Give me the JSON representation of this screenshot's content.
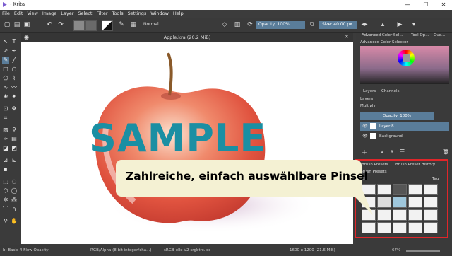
{
  "window": {
    "title": "- Krita",
    "minimize": "—",
    "maximize": "☐",
    "close": "✕"
  },
  "menu": [
    "File",
    "Edit",
    "View",
    "Image",
    "Layer",
    "Select",
    "Filter",
    "Tools",
    "Settings",
    "Window",
    "Help"
  ],
  "toolbar": {
    "blend_mode": "Normal",
    "opacity_label": "Opacity: 100%",
    "size_label": "Size: 40.00 px"
  },
  "canvas": {
    "tab_title": "Apple.kra (20.2 MiB)",
    "close": "✕",
    "watermark": "SAMPLE"
  },
  "dockers": {
    "color_tabs": [
      "Advanced Color Sel...",
      "Tool Op...",
      "Ove..."
    ],
    "color_selector_title": "Advanced Color Selector",
    "layer_tabs": [
      "Layers",
      "Channels"
    ],
    "layers_title": "Layers",
    "blend_mode": "Multiply",
    "opacity": "Opacity: 100%",
    "layers": [
      {
        "name": "Layer 8",
        "selected": true
      },
      {
        "name": "Background",
        "selected": false
      }
    ],
    "brush_tabs": [
      "Brush Presets",
      "Brush Preset History"
    ],
    "brush_presets_title": "Brush Presets",
    "tag_filter": "All",
    "tag_label": "Tag"
  },
  "callout": {
    "text": "Zahlreiche, einfach auswählbare Pinsel"
  },
  "status": {
    "brush": "b) Basic-4 Flow Opacity",
    "color_space": "RGB/Alpha (8-bit integer/cha...)",
    "profile": "sRGB-elle-V2-srgbtrc.icc",
    "dimensions": "1600 x 1200 (21.6 MiB)",
    "zoom": "67%"
  },
  "colors": {
    "accent": "#5a7d9a",
    "callout_bg": "#f4f1d3",
    "highlight": "#e0262a"
  }
}
